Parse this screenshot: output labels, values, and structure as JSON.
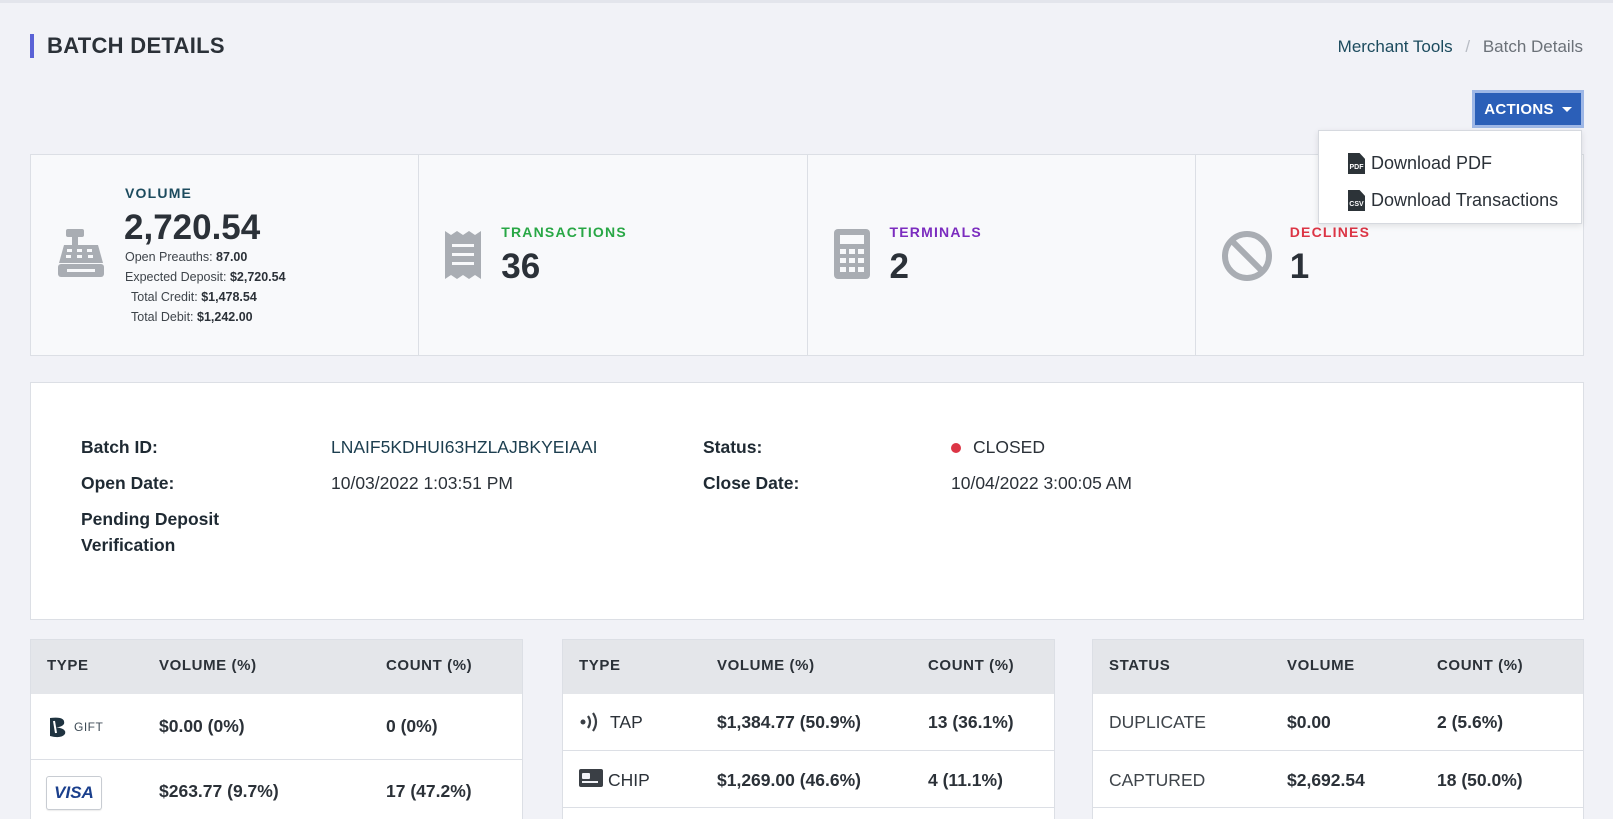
{
  "header": {
    "title": "BATCH DETAILS",
    "breadcrumb": {
      "link": "Merchant Tools",
      "separator": "/",
      "current": "Batch Details"
    },
    "actions_label": "ACTIONS"
  },
  "actions_menu": {
    "items": [
      {
        "icon": "pdf-file-icon",
        "label": "Download PDF"
      },
      {
        "icon": "csv-file-icon",
        "label": "Download Transactions"
      }
    ]
  },
  "stats": {
    "volume": {
      "label": "VOLUME",
      "value": "2,720.54",
      "open_preauths_label": "Open Preauths:",
      "open_preauths": "87.00",
      "expected_deposit_label": "Expected Deposit:",
      "expected_deposit": "$2,720.54",
      "total_credit_label": "Total Credit:",
      "total_credit": "$1,478.54",
      "total_debit_label": "Total Debit:",
      "total_debit": "$1,242.00",
      "icon": "cash-register-icon"
    },
    "transactions": {
      "label": "TRANSACTIONS",
      "value": "36",
      "icon": "receipt-icon",
      "color": "#28a745"
    },
    "terminals": {
      "label": "TERMINALS",
      "value": "2",
      "icon": "calculator-icon",
      "color": "#7b2cbf"
    },
    "declines": {
      "label": "DECLINES",
      "value": "1",
      "icon": "ban-icon",
      "color": "#dc3545"
    }
  },
  "details": {
    "batch_id_label": "Batch ID:",
    "batch_id": "LNAIF5KDHUI63HZLAJBKYEIAAI",
    "open_date_label": "Open Date:",
    "open_date": "10/03/2022 1:03:51 PM",
    "pending_label": "Pending Deposit Verification",
    "status_label": "Status:",
    "status": "CLOSED",
    "close_date_label": "Close Date:",
    "close_date": "10/04/2022 3:00:05 AM"
  },
  "card_types": {
    "headers": [
      "TYPE",
      "VOLUME (%)",
      "COUNT (%)"
    ],
    "rows": [
      {
        "type": "GIFT",
        "volume": "$0.00 (0%)",
        "count": "0 (0%)"
      },
      {
        "type": "VISA",
        "volume": "$263.77 (9.7%)",
        "count": "17 (47.2%)"
      }
    ]
  },
  "entry_types": {
    "headers": [
      "TYPE",
      "VOLUME (%)",
      "COUNT (%)"
    ],
    "rows": [
      {
        "type": "TAP",
        "icon": "contactless-icon",
        "volume": "$1,384.77 (50.9%)",
        "count": "13 (36.1%)"
      },
      {
        "type": "CHIP",
        "icon": "chip-card-icon",
        "volume": "$1,269.00 (46.6%)",
        "count": "4 (11.1%)"
      }
    ]
  },
  "statuses": {
    "headers": [
      "STATUS",
      "VOLUME",
      "COUNT (%)"
    ],
    "rows": [
      {
        "status": "DUPLICATE",
        "volume": "$0.00",
        "count": "2 (5.6%)"
      },
      {
        "status": "CAPTURED",
        "volume": "$2,692.54",
        "count": "18 (50.0%)"
      }
    ]
  },
  "colors": {
    "accent": "#5a62d6",
    "primary_button": "#2b5fb8",
    "volume_label": "#1c4b5e",
    "status_closed": "#dc3545"
  }
}
